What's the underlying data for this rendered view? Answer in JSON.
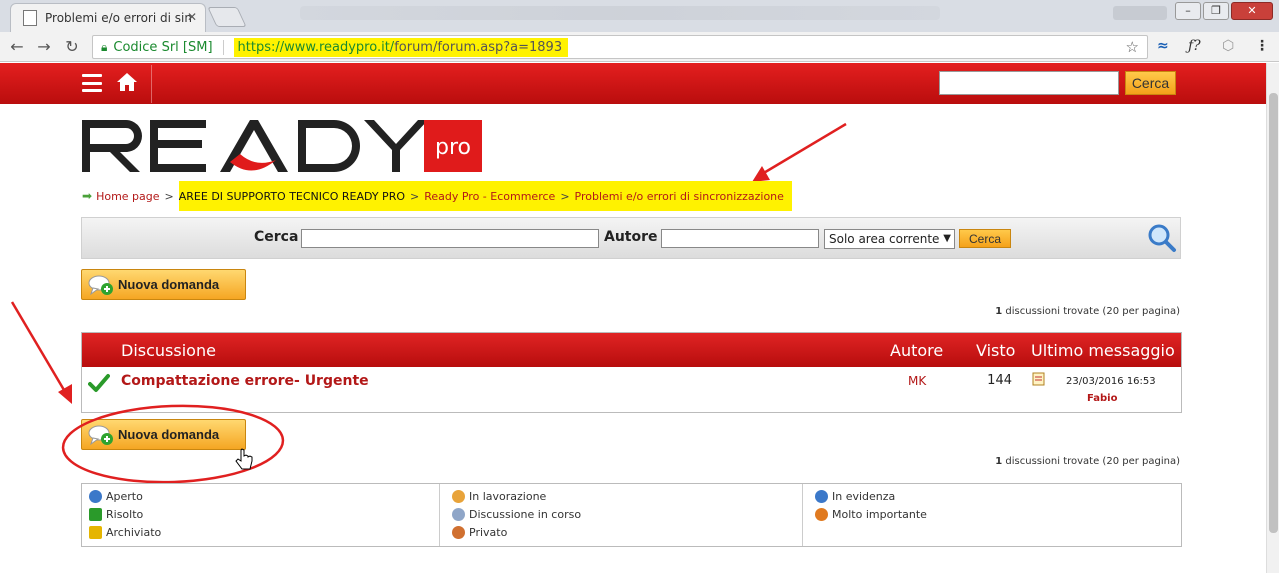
{
  "browser": {
    "tab_title": "Problemi e/o errori di sin",
    "tab_close": "✕",
    "secure_label": "Codice Srl [SM]",
    "url_highlighted": "https://www.readypro.it/",
    "url_rest": "forum/forum.asp?a=1893",
    "win_min": "–",
    "win_max": "❐",
    "win_close": "✕"
  },
  "header": {
    "search_button": "Cerca"
  },
  "breadcrumb": {
    "home": "Home page",
    "sep": ">",
    "area": "AREE DI SUPPORTO TECNICO READY PRO",
    "section": "Ready Pro - Ecommerce",
    "current": "Problemi e/o errori di sincronizzazione"
  },
  "search": {
    "cerca_label": "Cerca",
    "autore_label": "Autore",
    "scope_selected": "Solo area corrente",
    "button": "Cerca"
  },
  "buttons": {
    "new_question": "Nuova domanda"
  },
  "results": {
    "count": "1",
    "suffix": "discussioni trovate (20 per pagina)"
  },
  "table": {
    "headers": {
      "discussion": "Discussione",
      "author": "Autore",
      "views": "Visto",
      "last_message": "Ultimo messaggio"
    },
    "rows": [
      {
        "title": "Compattazione errore- Urgente",
        "author": "MK",
        "views": "144",
        "last_date": "23/03/2016 16:53",
        "last_user": "Fabio"
      }
    ]
  },
  "legend": {
    "col1": [
      "Aperto",
      "Risolto",
      "Archiviato"
    ],
    "col2": [
      "In lavorazione",
      "Discussione in corso",
      "Privato"
    ],
    "col3": [
      "In evidenza",
      "Molto importante"
    ]
  },
  "colors": {
    "header_red": "#cc1414",
    "link_red": "#b31818",
    "button_orange": "#f5a623",
    "highlight_yellow": "#fff200",
    "annotation_red": "#e02020"
  },
  "icons": {
    "home": "home-icon",
    "menu": "hamburger-icon",
    "search": "magnifier-icon",
    "check": "check-icon",
    "new_question": "speech-bubble-add-icon"
  }
}
